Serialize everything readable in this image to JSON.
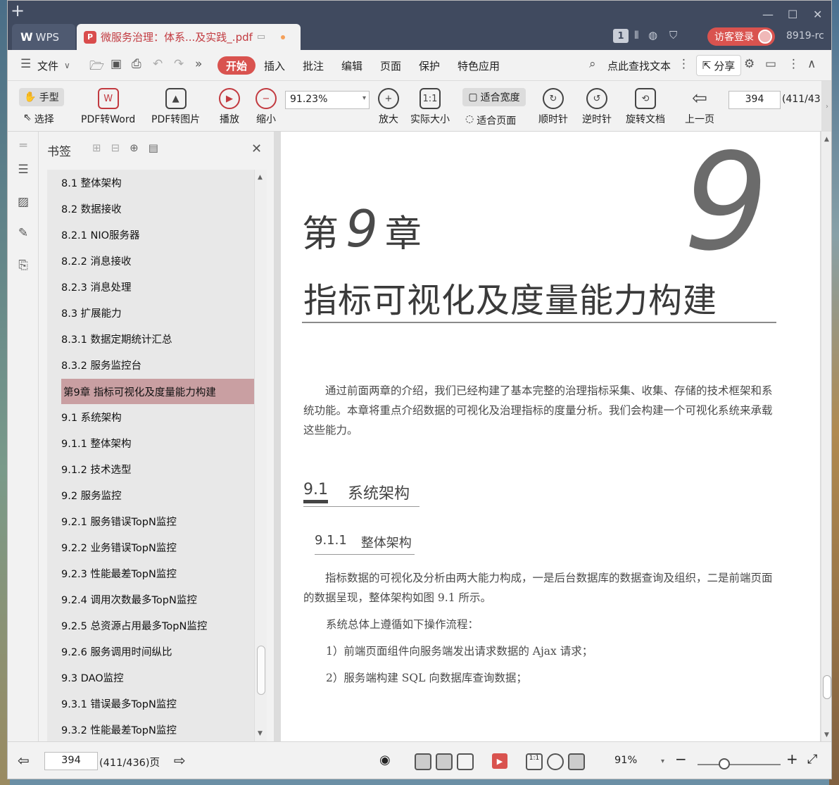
{
  "titlebar": {
    "app_tab": "WPS",
    "doc_tab": "微服务治理：体系...及实践_.pdf",
    "page_badge": "1",
    "login": "访客登录",
    "version": "8919-rc"
  },
  "menubar": {
    "file": "文件",
    "items": [
      "开始",
      "插入",
      "批注",
      "编辑",
      "页面",
      "保护",
      "特色应用"
    ],
    "search": "点此查找文本",
    "share": "分享"
  },
  "ribbon": {
    "hand": "手型",
    "select": "选择",
    "pdf_to_word": "PDF转Word",
    "pdf_to_image": "PDF转图片",
    "play": "播放",
    "zoom_out": "缩小",
    "zoom_value": "91.23%",
    "zoom_in": "放大",
    "actual_size": "实际大小",
    "fit_width": "适合宽度",
    "fit_page": "适合页面",
    "rotate_cw": "顺时针",
    "rotate_ccw": "逆时针",
    "rotate_doc": "旋转文档",
    "prev_page": "上一页",
    "page_num": "394",
    "page_total": "(411/43"
  },
  "bookmarks": {
    "title": "书签",
    "items": [
      "8.1  整体架构",
      "8.2  数据接收",
      "8.2.1  NIO服务器",
      "8.2.2  消息接收",
      "8.2.3  消息处理",
      "8.3  扩展能力",
      "8.3.1  数据定期统计汇总",
      "8.3.2  服务监控台",
      "第9章  指标可视化及度量能力构建",
      "9.1  系统架构",
      "9.1.1  整体架构",
      "9.1.2  技术选型",
      "9.2  服务监控",
      "9.2.1  服务错误TopN监控",
      "9.2.2  业务错误TopN监控",
      "9.2.3  性能最差TopN监控",
      "9.2.4  调用次数最多TopN监控",
      "9.2.5  总资源占用最多TopN监控",
      "9.2.6  服务调用时间纵比",
      "9.3  DAO监控",
      "9.3.1  错误最多TopN监控",
      "9.3.2  性能最差TopN监控"
    ],
    "selected_index": 8
  },
  "document": {
    "chapter_big_num": "9",
    "chapter_prefix": "第",
    "chapter_num": "9",
    "chapter_suffix": "章",
    "chapter_title": "指标可视化及度量能力构建",
    "intro": "通过前面两章的介绍，我们已经构建了基本完整的治理指标采集、收集、存储的技术框架和系统功能。本章将重点介绍数据的可视化及治理指标的度量分析。我们会构建一个可视化系统来承载这些能力。",
    "sec_num": "9.1",
    "sec_title": "系统架构",
    "subsec_num": "9.1.1",
    "subsec_title": "整体架构",
    "para2": "指标数据的可视化及分析由两大能力构成，一是后台数据库的数据查询及组织，二是前端页面的数据呈现，整体架构如图 9.1 所示。",
    "line_flow": "系统总体上遵循如下操作流程：",
    "step1": "1）前端页面组件向服务端发出请求数据的 Ajax 请求；",
    "step2": "2）服务端构建 SQL 向数据库查询数据；"
  },
  "status": {
    "page_num": "394",
    "page_total": "(411/436)页",
    "zoom": "91%",
    "zoom_fraction": 0.32
  }
}
